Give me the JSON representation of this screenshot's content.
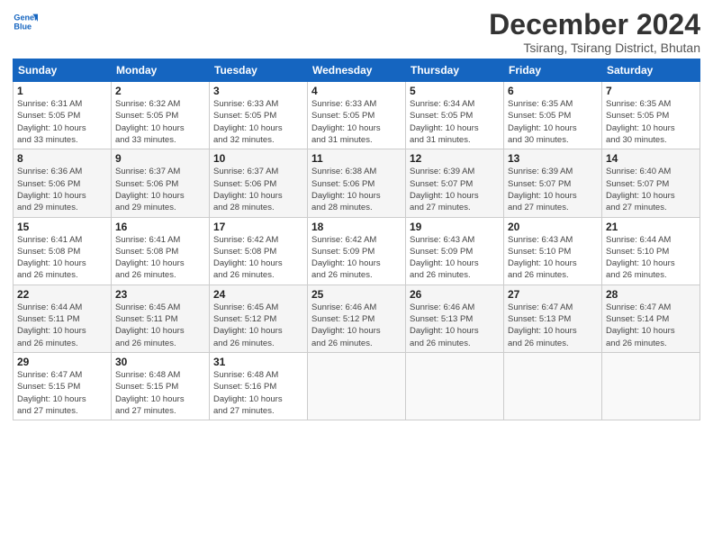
{
  "header": {
    "logo_line1": "General",
    "logo_line2": "Blue",
    "month_title": "December 2024",
    "subtitle": "Tsirang, Tsirang District, Bhutan"
  },
  "weekdays": [
    "Sunday",
    "Monday",
    "Tuesday",
    "Wednesday",
    "Thursday",
    "Friday",
    "Saturday"
  ],
  "weeks": [
    [
      {
        "day": "1",
        "detail": "Sunrise: 6:31 AM\nSunset: 5:05 PM\nDaylight: 10 hours\nand 33 minutes."
      },
      {
        "day": "2",
        "detail": "Sunrise: 6:32 AM\nSunset: 5:05 PM\nDaylight: 10 hours\nand 33 minutes."
      },
      {
        "day": "3",
        "detail": "Sunrise: 6:33 AM\nSunset: 5:05 PM\nDaylight: 10 hours\nand 32 minutes."
      },
      {
        "day": "4",
        "detail": "Sunrise: 6:33 AM\nSunset: 5:05 PM\nDaylight: 10 hours\nand 31 minutes."
      },
      {
        "day": "5",
        "detail": "Sunrise: 6:34 AM\nSunset: 5:05 PM\nDaylight: 10 hours\nand 31 minutes."
      },
      {
        "day": "6",
        "detail": "Sunrise: 6:35 AM\nSunset: 5:05 PM\nDaylight: 10 hours\nand 30 minutes."
      },
      {
        "day": "7",
        "detail": "Sunrise: 6:35 AM\nSunset: 5:05 PM\nDaylight: 10 hours\nand 30 minutes."
      }
    ],
    [
      {
        "day": "8",
        "detail": "Sunrise: 6:36 AM\nSunset: 5:06 PM\nDaylight: 10 hours\nand 29 minutes."
      },
      {
        "day": "9",
        "detail": "Sunrise: 6:37 AM\nSunset: 5:06 PM\nDaylight: 10 hours\nand 29 minutes."
      },
      {
        "day": "10",
        "detail": "Sunrise: 6:37 AM\nSunset: 5:06 PM\nDaylight: 10 hours\nand 28 minutes."
      },
      {
        "day": "11",
        "detail": "Sunrise: 6:38 AM\nSunset: 5:06 PM\nDaylight: 10 hours\nand 28 minutes."
      },
      {
        "day": "12",
        "detail": "Sunrise: 6:39 AM\nSunset: 5:07 PM\nDaylight: 10 hours\nand 27 minutes."
      },
      {
        "day": "13",
        "detail": "Sunrise: 6:39 AM\nSunset: 5:07 PM\nDaylight: 10 hours\nand 27 minutes."
      },
      {
        "day": "14",
        "detail": "Sunrise: 6:40 AM\nSunset: 5:07 PM\nDaylight: 10 hours\nand 27 minutes."
      }
    ],
    [
      {
        "day": "15",
        "detail": "Sunrise: 6:41 AM\nSunset: 5:08 PM\nDaylight: 10 hours\nand 26 minutes."
      },
      {
        "day": "16",
        "detail": "Sunrise: 6:41 AM\nSunset: 5:08 PM\nDaylight: 10 hours\nand 26 minutes."
      },
      {
        "day": "17",
        "detail": "Sunrise: 6:42 AM\nSunset: 5:08 PM\nDaylight: 10 hours\nand 26 minutes."
      },
      {
        "day": "18",
        "detail": "Sunrise: 6:42 AM\nSunset: 5:09 PM\nDaylight: 10 hours\nand 26 minutes."
      },
      {
        "day": "19",
        "detail": "Sunrise: 6:43 AM\nSunset: 5:09 PM\nDaylight: 10 hours\nand 26 minutes."
      },
      {
        "day": "20",
        "detail": "Sunrise: 6:43 AM\nSunset: 5:10 PM\nDaylight: 10 hours\nand 26 minutes."
      },
      {
        "day": "21",
        "detail": "Sunrise: 6:44 AM\nSunset: 5:10 PM\nDaylight: 10 hours\nand 26 minutes."
      }
    ],
    [
      {
        "day": "22",
        "detail": "Sunrise: 6:44 AM\nSunset: 5:11 PM\nDaylight: 10 hours\nand 26 minutes."
      },
      {
        "day": "23",
        "detail": "Sunrise: 6:45 AM\nSunset: 5:11 PM\nDaylight: 10 hours\nand 26 minutes."
      },
      {
        "day": "24",
        "detail": "Sunrise: 6:45 AM\nSunset: 5:12 PM\nDaylight: 10 hours\nand 26 minutes."
      },
      {
        "day": "25",
        "detail": "Sunrise: 6:46 AM\nSunset: 5:12 PM\nDaylight: 10 hours\nand 26 minutes."
      },
      {
        "day": "26",
        "detail": "Sunrise: 6:46 AM\nSunset: 5:13 PM\nDaylight: 10 hours\nand 26 minutes."
      },
      {
        "day": "27",
        "detail": "Sunrise: 6:47 AM\nSunset: 5:13 PM\nDaylight: 10 hours\nand 26 minutes."
      },
      {
        "day": "28",
        "detail": "Sunrise: 6:47 AM\nSunset: 5:14 PM\nDaylight: 10 hours\nand 26 minutes."
      }
    ],
    [
      {
        "day": "29",
        "detail": "Sunrise: 6:47 AM\nSunset: 5:15 PM\nDaylight: 10 hours\nand 27 minutes."
      },
      {
        "day": "30",
        "detail": "Sunrise: 6:48 AM\nSunset: 5:15 PM\nDaylight: 10 hours\nand 27 minutes."
      },
      {
        "day": "31",
        "detail": "Sunrise: 6:48 AM\nSunset: 5:16 PM\nDaylight: 10 hours\nand 27 minutes."
      },
      {
        "day": "",
        "detail": ""
      },
      {
        "day": "",
        "detail": ""
      },
      {
        "day": "",
        "detail": ""
      },
      {
        "day": "",
        "detail": ""
      }
    ]
  ]
}
